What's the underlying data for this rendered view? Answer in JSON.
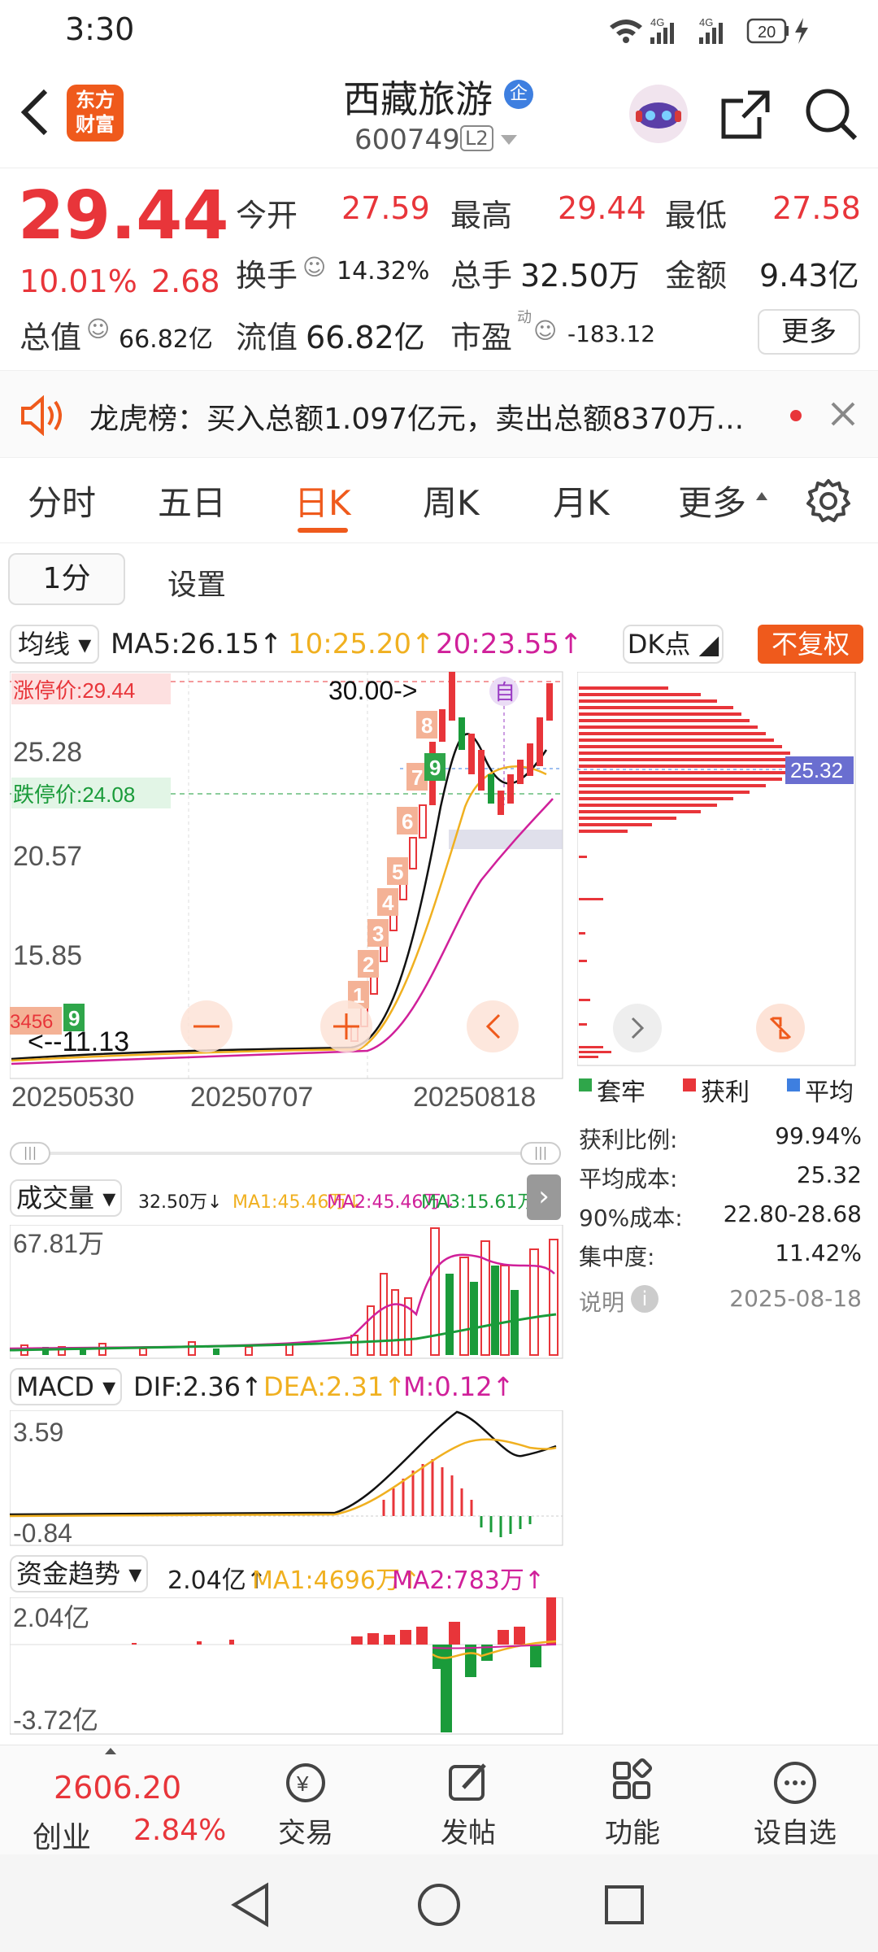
{
  "status": {
    "time": "3:30",
    "net1": "4G",
    "net2": "4G",
    "battery": "20"
  },
  "header": {
    "app_logo": "东方\n财富",
    "app_logo_line1": "东方",
    "app_logo_line2": "财富",
    "stock_name": "西藏旅游",
    "badge": "企",
    "stock_code": "600749",
    "level": "L2"
  },
  "quote": {
    "price": "29.44",
    "change_pct": "10.01%",
    "change_amt": "2.68",
    "open_label": "今开",
    "open": "27.59",
    "high_label": "最高",
    "high": "29.44",
    "low_label": "最低",
    "low": "27.58",
    "turnover_label": "换手",
    "turnover": "14.32%",
    "volume_label": "总手",
    "volume": "32.50万",
    "amount_label": "金额",
    "amount": "9.43亿",
    "mktcap_label": "总值",
    "mktcap": "66.82亿",
    "float_label": "流值",
    "float": "66.82亿",
    "pe_label": "市盈",
    "pe_sup": "动",
    "pe": "-183.12",
    "more": "更多"
  },
  "notice": {
    "text": "龙虎榜：买入总额1.097亿元，卖出总额8370万..."
  },
  "tabs": [
    {
      "label": "分时"
    },
    {
      "label": "五日"
    },
    {
      "label": "日K"
    },
    {
      "label": "周K"
    },
    {
      "label": "月K"
    },
    {
      "label": "更多"
    }
  ],
  "subbar": {
    "period": "1分",
    "settings": "设置"
  },
  "ma": {
    "selector": "均线",
    "ma5": "MA5:26.15↑",
    "ma10": "10:25.20↑",
    "ma20": "20:23.55↑",
    "dk": "DK点",
    "fuquan": "不复权",
    "colors": {
      "ma5": "#222222",
      "ma10": "#f0b020",
      "ma20": "#d0209a"
    }
  },
  "kline": {
    "limit_up": "涨停价:29.44",
    "limit_down": "跌停价:24.08",
    "target": "30.00->",
    "self_mark": "自",
    "y_ticks": [
      "25.28",
      "20.57",
      "15.85"
    ],
    "low_label": "<--11.13",
    "x_ticks": [
      "20250530",
      "20250707",
      "20250818"
    ],
    "nums": [
      "1",
      "2",
      "3",
      "4",
      "5",
      "6",
      "7",
      "8",
      "9",
      "9"
    ],
    "left_stack": "3456",
    "cost_price": "25.32"
  },
  "chip": {
    "legend": [
      "套牢",
      "获利",
      "平均"
    ],
    "rows": [
      {
        "label": "获利比例:",
        "value": "99.94%"
      },
      {
        "label": "平均成本:",
        "value": "25.32"
      },
      {
        "label": "90%成本:",
        "value": "22.80-28.68"
      },
      {
        "label": "集中度:",
        "value": "11.42%"
      }
    ],
    "note_label": "说明",
    "date": "2025-08-18"
  },
  "volume": {
    "selector": "成交量",
    "vol": "32.50万↓",
    "ma1": "MA1:45.46万↓",
    "ma2": "MA2:45.46万↓",
    "ma3": "MA3:15.61万↑",
    "max": "67.81万"
  },
  "macd": {
    "selector": "MACD",
    "dif": "DIF:2.36↑",
    "dea": "DEA:2.31↑",
    "m": "M:0.12↑",
    "max": "3.59",
    "min": "-0.84"
  },
  "fund": {
    "selector": "资金趋势",
    "val": "2.04亿↑",
    "ma1": "MA1:4696万↑",
    "ma2": "MA2:783万↑",
    "max": "2.04亿",
    "min": "-3.72亿"
  },
  "bottom": {
    "index_value": "2606.20",
    "index_name": "创业",
    "index_pct": "2.84%",
    "items": [
      {
        "label": "交易"
      },
      {
        "label": "发帖"
      },
      {
        "label": "功能"
      },
      {
        "label": "设自选"
      }
    ]
  }
}
